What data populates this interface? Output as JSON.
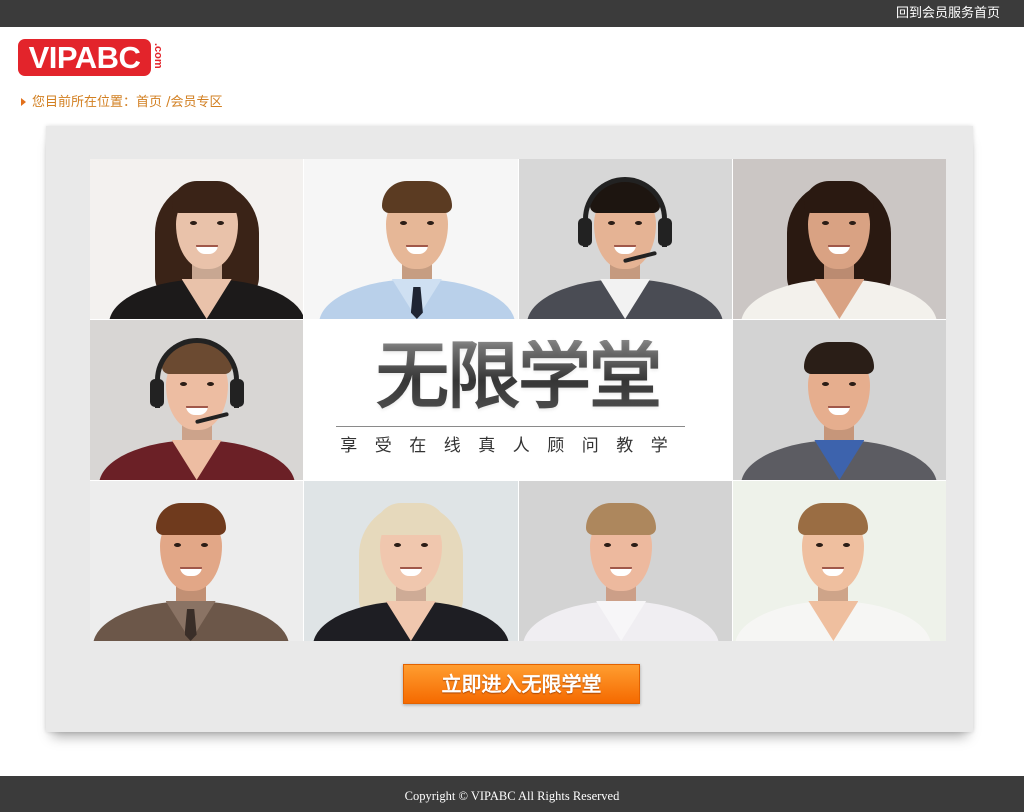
{
  "top_bar": {
    "link_label": "回到会员服务首页"
  },
  "logo": {
    "text": "VIPABC",
    "suffix": ".com"
  },
  "breadcrumb": {
    "marker_icon": "caret-right-icon",
    "prefix": "您目前所在位置：",
    "home": "首页",
    "separator": " /",
    "current": "会员专区"
  },
  "banner": {
    "title": "无限学堂",
    "subtitle": "享受在线真人顾问教学"
  },
  "cta": {
    "label": "立即进入无限学堂"
  },
  "footer": {
    "copyright": "Copyright © VIPABC All Rights Reserved"
  },
  "colors": {
    "top_bar": "#3b3b3b",
    "logo_red": "#e3242b",
    "breadcrumb": "#d27f21",
    "panel": "#e9e9e9",
    "cta_orange": "#f56a00",
    "footer": "#3b3b3b"
  }
}
